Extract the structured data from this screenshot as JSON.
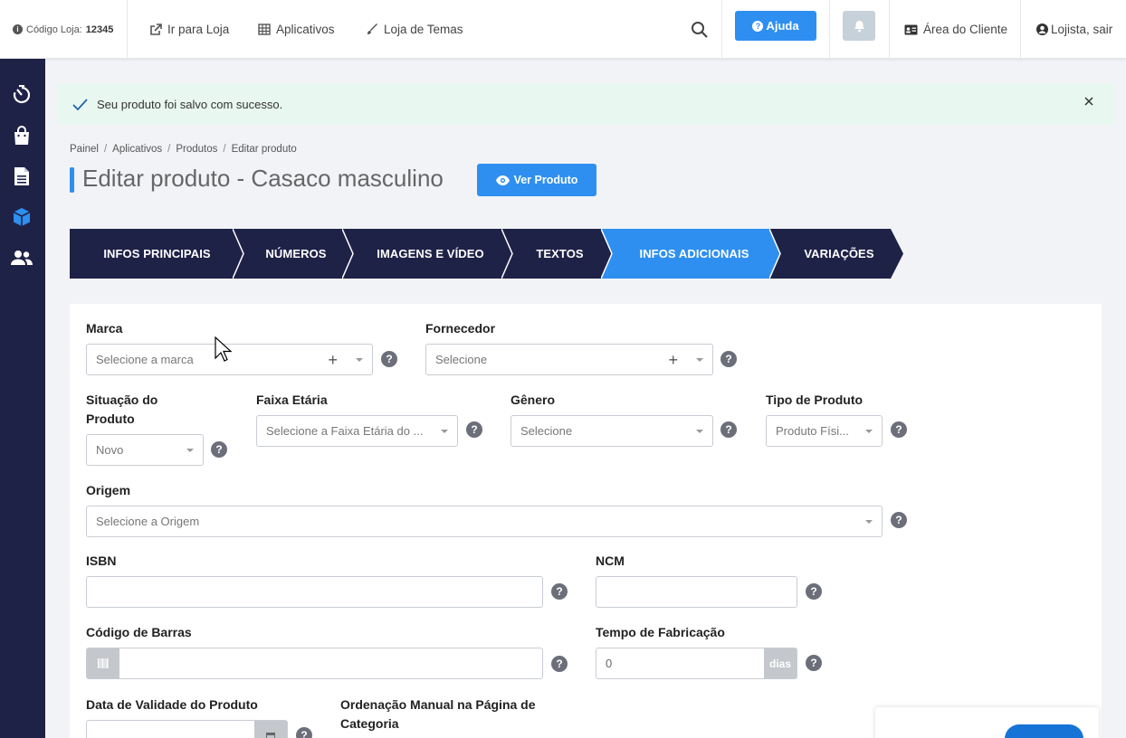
{
  "topbar": {
    "store_code_label": "Código Loja:",
    "store_code_value": "12345",
    "go_to_store": "Ir para Loja",
    "apps": "Aplicativos",
    "themes": "Loja de Temas",
    "help": "Ajuda",
    "client_area": "Área do Cliente",
    "logout": "Lojista, sair"
  },
  "sidebar": {
    "items": [
      "dashboard-icon",
      "orders-bag-icon",
      "document-icon",
      "products-box-icon",
      "customers-icon"
    ],
    "active_color": "#2e8ff0"
  },
  "alert": {
    "message": "Seu produto foi salvo com sucesso."
  },
  "breadcrumb": [
    "Painel",
    "Aplicativos",
    "Produtos",
    "Editar produto"
  ],
  "page": {
    "title": "Editar produto - Casaco masculino",
    "view_button": "Ver Produto"
  },
  "steps": [
    {
      "label": "INFOS PRINCIPAIS",
      "active": false
    },
    {
      "label": "NÚMEROS",
      "active": false
    },
    {
      "label": "IMAGENS E VÍDEO",
      "active": false
    },
    {
      "label": "TEXTOS",
      "active": false
    },
    {
      "label": "INFOS ADICIONAIS",
      "active": true
    },
    {
      "label": "VARIAÇÕES",
      "active": false
    }
  ],
  "colors": {
    "step_dark": "#1f2247",
    "step_active": "#2e8ff0",
    "primary": "#2e8ff0"
  },
  "form": {
    "marca": {
      "label": "Marca",
      "placeholder": "Selecione a marca"
    },
    "fornecedor": {
      "label": "Fornecedor",
      "placeholder": "Selecione"
    },
    "situacao": {
      "label_line1": "Situação do",
      "label_line2": "Produto",
      "value": "Novo"
    },
    "faixa": {
      "label": "Faixa Etária",
      "placeholder": "Selecione a Faixa Etária do ..."
    },
    "genero": {
      "label": "Gênero",
      "placeholder": "Selecione"
    },
    "tipo": {
      "label": "Tipo de Produto",
      "value": "Produto Físi..."
    },
    "origem": {
      "label": "Origem",
      "placeholder": "Selecione a Origem"
    },
    "isbn": {
      "label": "ISBN",
      "value": ""
    },
    "ncm": {
      "label": "NCM",
      "value": ""
    },
    "barras": {
      "label": "Código de Barras",
      "value": ""
    },
    "tempo": {
      "label": "Tempo de Fabricação",
      "value": "0",
      "suffix": "dias"
    },
    "validade": {
      "label": "Data de Validade do Produto"
    },
    "ordenacao": {
      "label_line1": "Ordenação Manual na Página de",
      "label_line2": "Categoria"
    }
  }
}
